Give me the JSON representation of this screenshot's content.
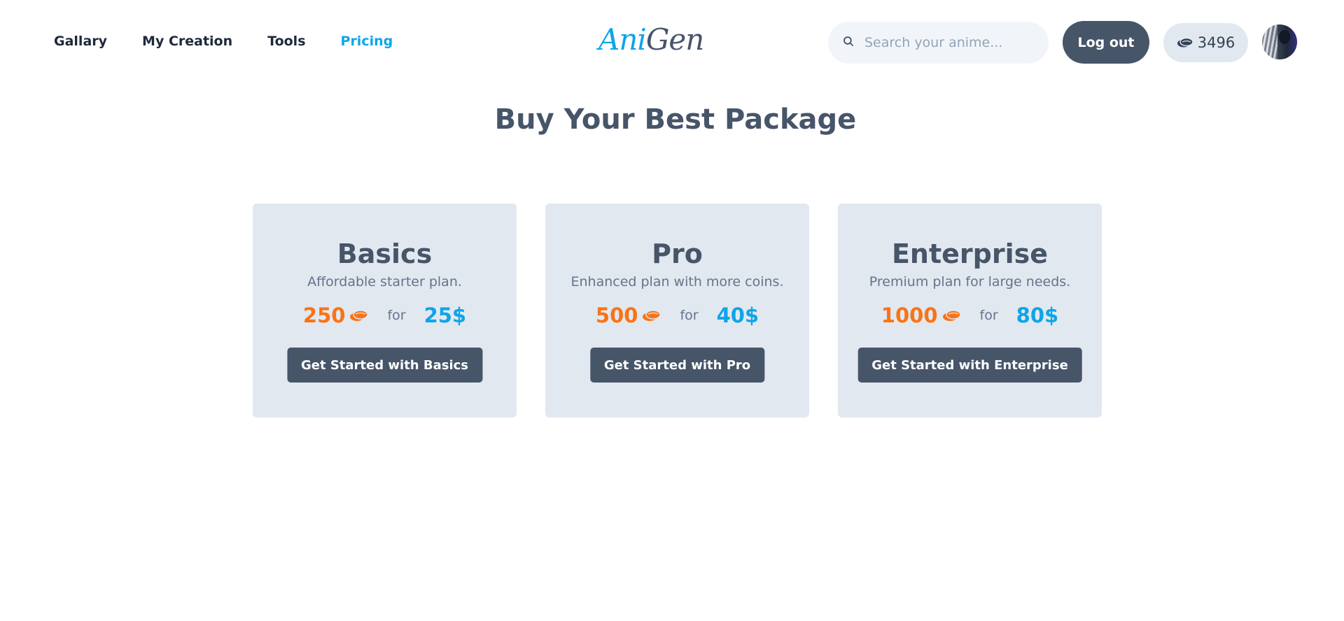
{
  "nav": {
    "links": [
      {
        "label": "Gallary",
        "active": false
      },
      {
        "label": "My Creation",
        "active": false
      },
      {
        "label": "Tools",
        "active": false
      },
      {
        "label": "Pricing",
        "active": true
      }
    ]
  },
  "logo": {
    "part1": "Ani",
    "part2": "Gen"
  },
  "search": {
    "placeholder": "Search your anime..."
  },
  "header": {
    "logout_label": "Log out",
    "coin_balance": "3496"
  },
  "page": {
    "heading": "Buy Your Best Package"
  },
  "plans": [
    {
      "title": "Basics",
      "description": "Affordable starter plan.",
      "coins": "250",
      "for_label": "for",
      "price": "25$",
      "cta": "Get Started with Basics"
    },
    {
      "title": "Pro",
      "description": "Enhanced plan with more coins.",
      "coins": "500",
      "for_label": "for",
      "price": "40$",
      "cta": "Get Started with Pro"
    },
    {
      "title": "Enterprise",
      "description": "Premium plan for large needs.",
      "coins": "1000",
      "for_label": "for",
      "price": "80$",
      "cta": "Get Started with Enterprise"
    }
  ],
  "colors": {
    "accent": "#0ea5e9",
    "coins": "#f97316",
    "dark": "#475569",
    "card_bg": "#e2e8f0"
  },
  "icons": {
    "search": "search-icon",
    "coins": "coins-icon",
    "avatar": "user-avatar"
  }
}
